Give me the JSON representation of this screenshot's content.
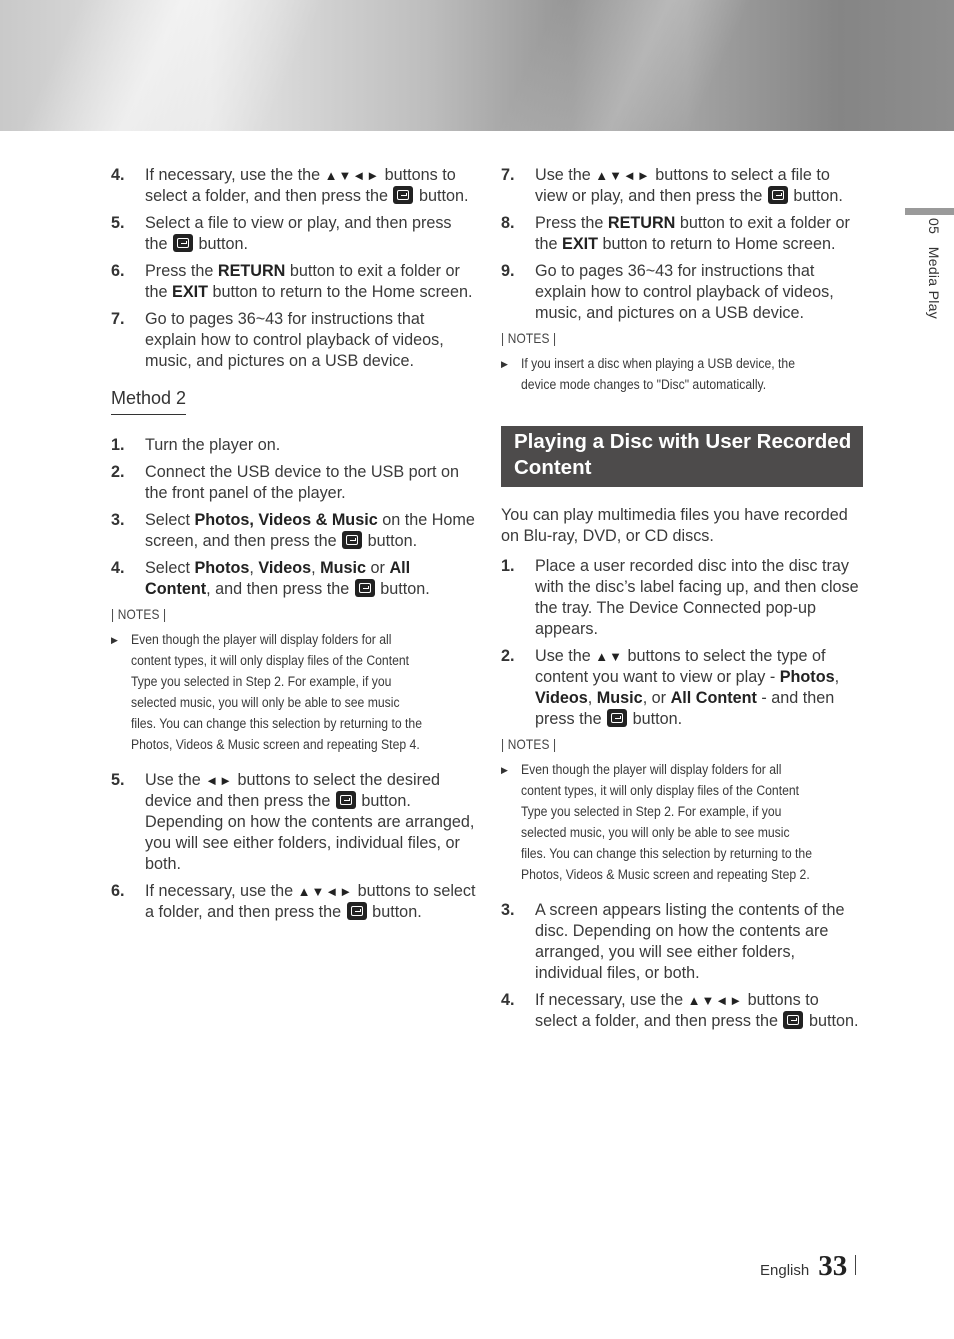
{
  "left_column": {
    "steps_a": [
      {
        "num": "4.",
        "parts": [
          {
            "t": "If necessary, use the the "
          },
          {
            "arrows": "▲▼◄►"
          },
          {
            "t": " buttons to select a folder, and then press the "
          },
          {
            "icon": "enter"
          },
          {
            "t": " button."
          }
        ]
      },
      {
        "num": "5.",
        "parts": [
          {
            "t": "Select a file to view or play, and then press the "
          },
          {
            "icon": "enter"
          },
          {
            "t": " button."
          }
        ]
      },
      {
        "num": "6.",
        "parts": [
          {
            "t": "Press the "
          },
          {
            "b": "RETURN"
          },
          {
            "t": " button to exit a folder or the "
          },
          {
            "b": "EXIT"
          },
          {
            "t": " button to return to the Home screen."
          }
        ]
      },
      {
        "num": "7.",
        "parts": [
          {
            "t": "Go to pages 36~43 for instructions that explain how to control playback of videos, music, and pictures on a USB device."
          }
        ]
      }
    ],
    "method_heading": "Method 2",
    "steps_b": [
      {
        "num": "1.",
        "parts": [
          {
            "t": "Turn the player on."
          }
        ]
      },
      {
        "num": "2.",
        "parts": [
          {
            "t": "Connect the USB device to the USB port on the front panel of the player."
          }
        ]
      },
      {
        "num": "3.",
        "parts": [
          {
            "t": "Select "
          },
          {
            "b": "Photos, Videos & Music"
          },
          {
            "t": " on the Home screen, and then press the "
          },
          {
            "icon": "enter"
          },
          {
            "t": " button."
          }
        ]
      },
      {
        "num": "4.",
        "parts": [
          {
            "t": "Select "
          },
          {
            "b": "Photos"
          },
          {
            "t": ", "
          },
          {
            "b": "Videos"
          },
          {
            "t": ", "
          },
          {
            "b": "Music"
          },
          {
            "t": " or "
          },
          {
            "b": "All Content"
          },
          {
            "t": ", and then press the "
          },
          {
            "icon": "enter"
          },
          {
            "t": " button."
          }
        ]
      }
    ],
    "notes_label": "| NOTES |",
    "notes": [
      "Even though the player will display folders for all content types, it will only display files of the Content Type you selected in Step 2. For example, if you selected music, you will only be able to see music files. You can change this selection by returning to the Photos, Videos & Music screen and repeating Step 4."
    ],
    "steps_c": [
      {
        "num": "5.",
        "parts": [
          {
            "t": "Use the "
          },
          {
            "arrows": "◄►"
          },
          {
            "t": " buttons to select the desired device and then press the "
          },
          {
            "icon": "enter"
          },
          {
            "t": " button. Depending on how the contents are arranged, you will see either folders, individual files, or both."
          }
        ]
      },
      {
        "num": "6.",
        "parts": [
          {
            "t": "If necessary, use the "
          },
          {
            "arrows": "▲▼◄►"
          },
          {
            "t": " buttons to select a folder, and then press the "
          },
          {
            "icon": "enter"
          },
          {
            "t": " button."
          }
        ]
      }
    ]
  },
  "right_column": {
    "steps_a": [
      {
        "num": "7.",
        "parts": [
          {
            "t": "Use the "
          },
          {
            "arrows": "▲▼◄►"
          },
          {
            "t": " buttons to select a file to view or play, and then press the "
          },
          {
            "icon": "enter"
          },
          {
            "t": " button."
          }
        ]
      },
      {
        "num": "8.",
        "parts": [
          {
            "t": "Press the "
          },
          {
            "b": "RETURN"
          },
          {
            "t": " button to exit a folder or the "
          },
          {
            "b": "EXIT"
          },
          {
            "t": " button to return to Home screen."
          }
        ]
      },
      {
        "num": "9.",
        "parts": [
          {
            "t": "Go to pages 36~43 for instructions that explain how to control playback of videos, music, and pictures on a USB device."
          }
        ]
      }
    ],
    "notes_label_1": "| NOTES |",
    "notes_1": [
      "If you insert a disc when playing a USB device, the device mode changes to \"Disc\" automatically."
    ],
    "section_title": "Playing a Disc with User Recorded Content",
    "intro": "You can play multimedia files you have recorded on Blu-ray, DVD, or CD discs.",
    "steps_b": [
      {
        "num": "1.",
        "parts": [
          {
            "t": "Place a user recorded disc into the disc tray with the disc’s label facing up, and then close the tray. The Device Connected pop-up appears."
          }
        ]
      },
      {
        "num": "2.",
        "parts": [
          {
            "t": "Use the "
          },
          {
            "arrows": "▲▼"
          },
          {
            "t": " buttons to select the type of content you want to view or play - "
          },
          {
            "b": "Photos"
          },
          {
            "t": ", "
          },
          {
            "b": "Videos"
          },
          {
            "t": ", "
          },
          {
            "b": "Music"
          },
          {
            "t": ", or "
          },
          {
            "b": "All Content"
          },
          {
            "t": " - and then press the "
          },
          {
            "icon": "enter"
          },
          {
            "t": " button."
          }
        ]
      }
    ],
    "notes_label_2": "| NOTES |",
    "notes_2": [
      "Even though the player will display folders for all content types, it will only display files of the Content Type you selected in Step 2. For example, if you selected music, you will only be able to see music files. You can change this selection by returning to the Photos, Videos & Music screen and repeating Step 2."
    ],
    "steps_c": [
      {
        "num": "3.",
        "parts": [
          {
            "t": "A screen appears listing the contents of the disc. Depending on how the contents are arranged, you will see either folders, individual files, or both."
          }
        ]
      },
      {
        "num": "4.",
        "parts": [
          {
            "t": "If necessary, use the "
          },
          {
            "arrows": "▲▼◄►"
          },
          {
            "t": " buttons to select a folder, and then press the "
          },
          {
            "icon": "enter"
          },
          {
            "t": " button."
          }
        ]
      }
    ]
  },
  "side_tab": {
    "chapter": "05",
    "title": "Media Play"
  },
  "footer": {
    "language": "English",
    "page_number": "33"
  },
  "colors": {
    "section_title_bg": "#4d4b4b",
    "side_tab_bar": "#9a9a9a"
  }
}
